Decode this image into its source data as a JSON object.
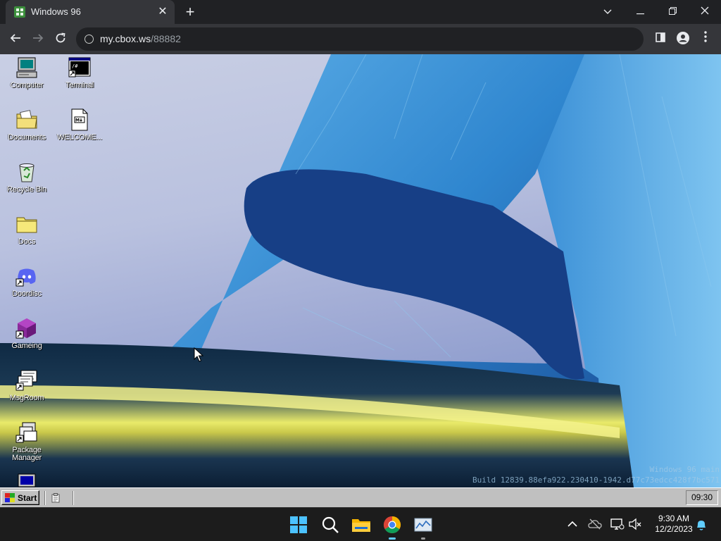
{
  "browser": {
    "tab_title": "Windows 96",
    "url_host": "my.cbox.ws",
    "url_path": "/88882"
  },
  "desktop": {
    "icons": [
      {
        "label": "Computer"
      },
      {
        "label": "Terminal"
      },
      {
        "label": "Documents"
      },
      {
        "label": "WELCOME..."
      },
      {
        "label": "Recycle Bin"
      },
      {
        "label": "Docs"
      },
      {
        "label": "Doordisc"
      },
      {
        "label": "Gameing"
      },
      {
        "label": "MsgRoom"
      },
      {
        "label": "Package Manager"
      }
    ],
    "watermark_line1": "Windows 96 main",
    "watermark_line2": "Build 12839.88efa922.230410-1942.d77c73edcc428f7bc571"
  },
  "w96_taskbar": {
    "start_label": "Start",
    "tray_time": "09:30"
  },
  "os_taskbar": {
    "time": "9:30 AM",
    "date": "12/2/2023"
  },
  "colors": {
    "accent": "#60cdff",
    "win96_gray": "#c0c0c0"
  }
}
